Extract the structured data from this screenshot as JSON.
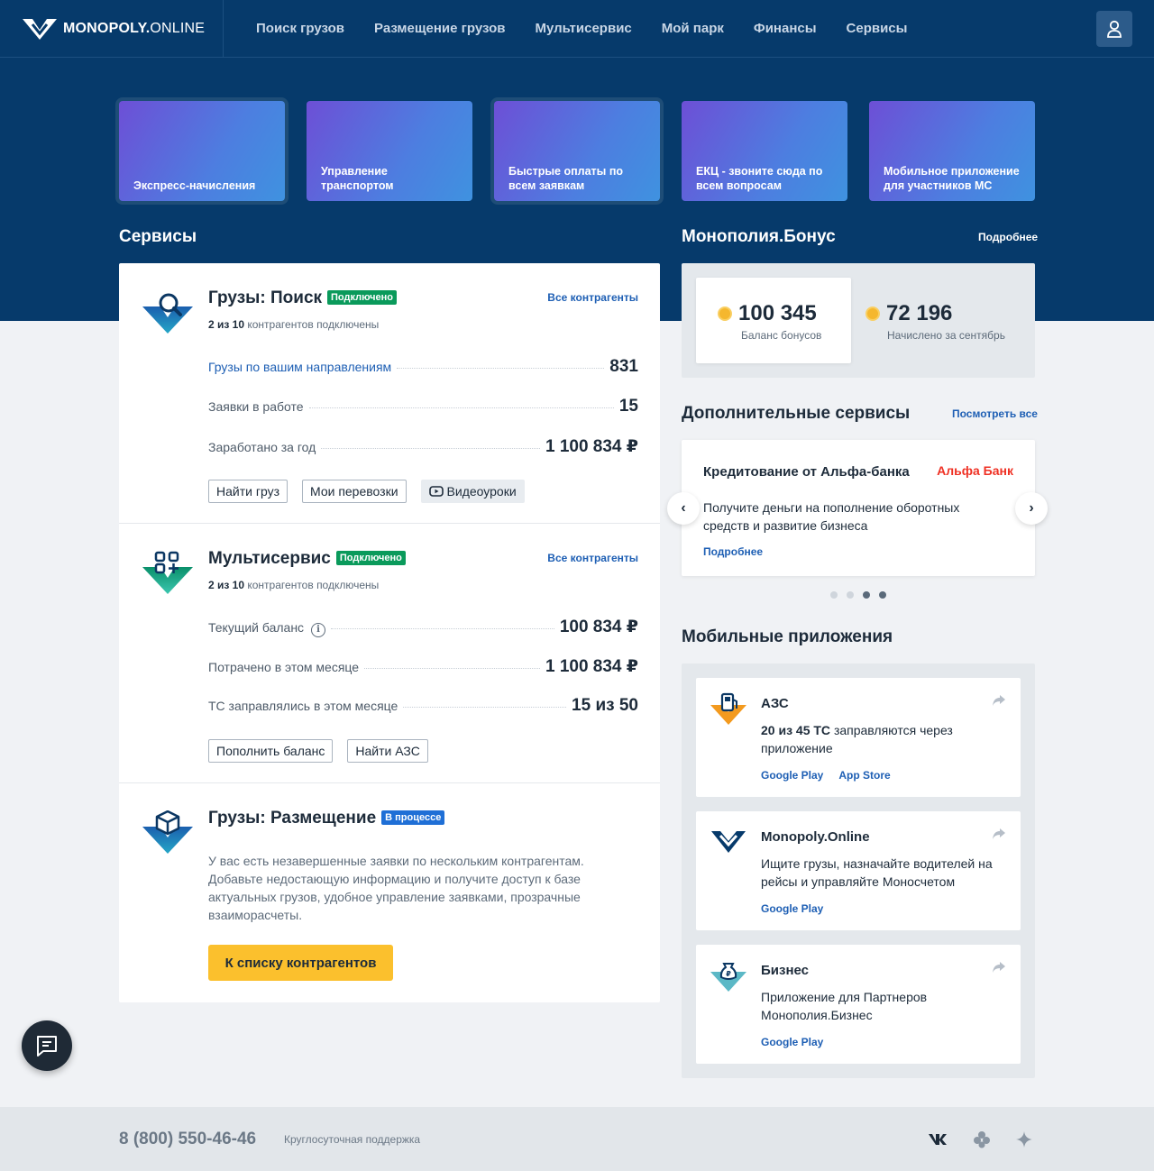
{
  "header": {
    "logo_bold": "MONOPOLY.",
    "logo_rest": "ONLINE",
    "nav": [
      "Поиск грузов",
      "Размещение грузов",
      "Мультисервис",
      "Мой парк",
      "Финансы",
      "Сервисы"
    ]
  },
  "tiles": [
    "Экспресс-начисления",
    "Управление транспортом",
    "Быстрые оплаты по всем заявкам",
    "ЕКЦ - звоните сюда по всем вопросам",
    "Мобильное приложение для участников МС"
  ],
  "services": {
    "title": "Сервисы",
    "cargo_search": {
      "title": "Грузы: Поиск",
      "badge": "Подключено",
      "sub_a": "2 из 10",
      "sub_b": "контрагентов подключены",
      "link": "Все контрагенты",
      "rows": [
        {
          "label": "Грузы по вашим направлениям",
          "value": "831"
        },
        {
          "label": "Заявки в работе",
          "value": "15"
        },
        {
          "label": "Заработано за год",
          "value": "1 100 834 ₽"
        }
      ],
      "buttons": [
        "Найти груз",
        "Мои перевозки",
        "Видеоуроки"
      ]
    },
    "multiservice": {
      "title": "Мультисервис",
      "badge": "Подключено",
      "sub_a": "2 из 10",
      "sub_b": "контрагентов подключены",
      "link": "Все контрагенты",
      "info": "i",
      "rows": [
        {
          "label": "Текущий баланс",
          "value": "100 834 ₽"
        },
        {
          "label": "Потрачено в этом месяце",
          "value": "1 100 834 ₽"
        },
        {
          "label": "ТС заправлялись в этом месяце",
          "value": "15 из 50"
        }
      ],
      "buttons": [
        "Пополнить баланс",
        "Найти АЗС"
      ]
    },
    "cargo_place": {
      "title": "Грузы: Размещение",
      "badge": "В процессе",
      "text": "У вас есть незавершенные заявки по нескольким контрагентам. Добавьте недостающую информацию и получите доступ к базе актуальных грузов, удобное управление заявками, прозрачные взаиморасчеты.",
      "button": "К списку контрагентов"
    }
  },
  "bonus": {
    "title": "Монополия.Бонус",
    "link": "Подробнее",
    "balance": "100 345",
    "balance_label": "Баланс бонусов",
    "accrued": "72 196",
    "accrued_label": "Начислено за сентябрь"
  },
  "extra": {
    "title": "Дополнительные сервисы",
    "link": "Посмотреть все",
    "card_title": "Кредитование от Альфа-банка",
    "bank": "Альфа Банк",
    "card_text": "Получите деньги на пополнение оборотных средств и развитие бизнеса",
    "card_link": "Подробнее",
    "prev": "‹",
    "next": "›"
  },
  "apps": {
    "title": "Мобильные приложения",
    "items": [
      {
        "name": "АЗС",
        "text_bold": "20 из 45 ТС",
        "text": "заправляются через приложение",
        "links": [
          "Google Play",
          "App Store"
        ]
      },
      {
        "name": "Monopoly.Online",
        "text": "Ищите грузы, назначайте водителей на рейсы и управляйте Моносчетом",
        "links": [
          "Google Play"
        ]
      },
      {
        "name": "Бизнес",
        "text": "Приложение для Партнеров Монополия.Бизнес",
        "links": [
          "Google Play"
        ]
      }
    ]
  },
  "footer": {
    "phone": "8 (800) 550-46-46",
    "support": "Круглосуточная поддержка"
  },
  "colors": {
    "navy": "#063a6b",
    "accent": "#1e5fb4",
    "green": "#0a9a5b",
    "yellow": "#fbc02d"
  }
}
